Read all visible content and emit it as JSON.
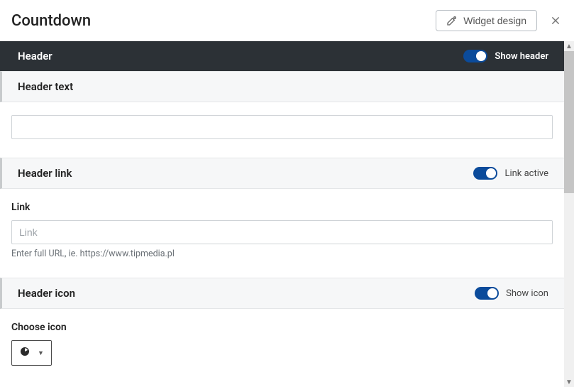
{
  "title": "Countdown",
  "widget_design_label": "Widget design",
  "sections": {
    "header": {
      "label": "Header",
      "toggle_label": "Show header",
      "toggle_on": true
    },
    "header_text": {
      "label": "Header text",
      "value": ""
    },
    "header_link": {
      "label": "Header link",
      "toggle_label": "Link active",
      "toggle_on": true,
      "link_label": "Link",
      "link_placeholder": "Link",
      "link_value": "",
      "helper": "Enter full URL, ie. https://www.tipmedia.pl"
    },
    "header_icon": {
      "label": "Header icon",
      "toggle_label": "Show icon",
      "toggle_on": true,
      "choose_label": "Choose icon",
      "selected_icon": "clock-icon"
    }
  }
}
